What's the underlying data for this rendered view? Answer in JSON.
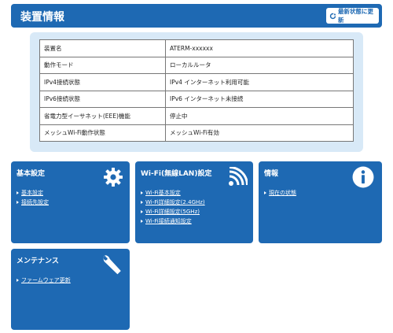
{
  "header": {
    "title": "装置情報",
    "refresh_label": "最新状態に更新"
  },
  "status_table": [
    {
      "label": "装置名",
      "value": "ATERM-xxxxxx"
    },
    {
      "label": "動作モード",
      "value": "ローカルルータ"
    },
    {
      "label": "IPv4接続状態",
      "value": "IPv4 インターネット利用可能"
    },
    {
      "label": "IPv6接続状態",
      "value": "IPv6 インターネット未接続"
    },
    {
      "label": "省電力型イーサネット(EEE)機能",
      "value": "停止中"
    },
    {
      "label": "メッシュWi-Fi動作状態",
      "value": "メッシュWi-Fi有効"
    }
  ],
  "cards": {
    "basic": {
      "title": "基本設定",
      "links": [
        "基本設定",
        "接続先設定"
      ]
    },
    "wifi": {
      "title": "Wi-Fi(無線LAN)設定",
      "links": [
        "Wi-Fi基本設定",
        "Wi-Fi詳細設定(2.4GHz)",
        "Wi-Fi詳細設定(5GHz)",
        "Wi-Fi接続通知設定"
      ]
    },
    "info": {
      "title": "情報",
      "links": [
        "現在の状態"
      ]
    },
    "maintenance": {
      "title": "メンテナンス",
      "links": [
        "ファームウェア更新"
      ]
    }
  },
  "icons": {
    "basic": "gear-icon",
    "wifi": "wifi-icon",
    "info": "info-icon",
    "maintenance": "wrench-icon",
    "refresh": "refresh-icon"
  },
  "colors": {
    "primary": "#1e69b3",
    "panel": "#d8e9f7"
  }
}
